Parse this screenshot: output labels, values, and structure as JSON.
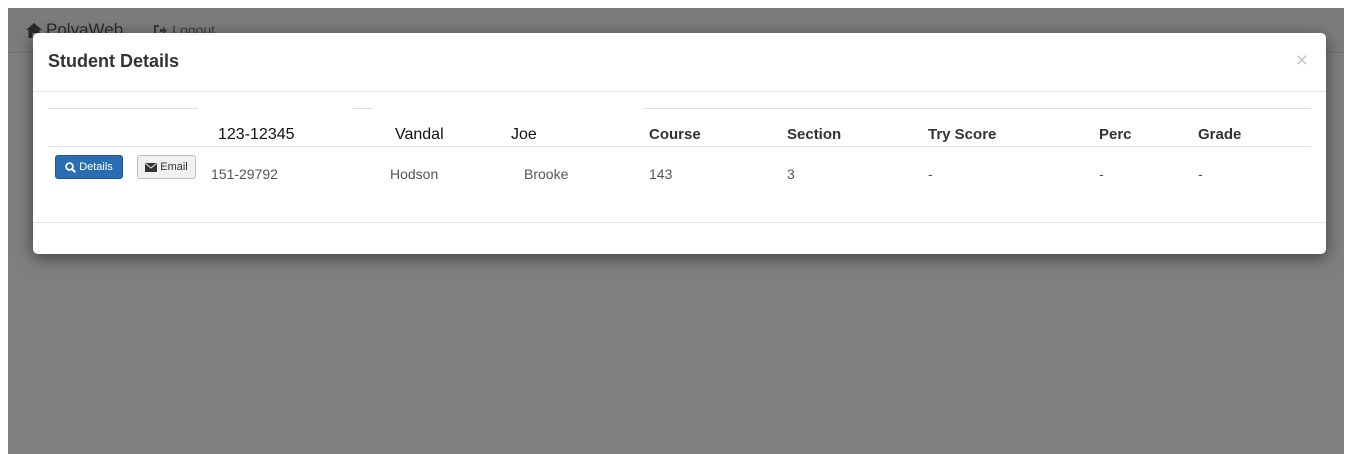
{
  "navbar": {
    "brand": "PolyaWeb",
    "logout": "Logout"
  },
  "modal": {
    "title": "Student Details",
    "close": "×",
    "header_row": {
      "id": "123-12345",
      "last": "Vandal",
      "first": "Joe",
      "course": "Course",
      "section": "Section",
      "try_score": "Try Score",
      "perc": "Perc",
      "grade": "Grade"
    },
    "row": {
      "details_button": "Details",
      "email_button": "Email",
      "id": "151-29792",
      "last": "Hodson",
      "first": "Brooke",
      "course": "143",
      "section": "3",
      "try_score": "-",
      "perc": "-",
      "grade": "-"
    }
  }
}
